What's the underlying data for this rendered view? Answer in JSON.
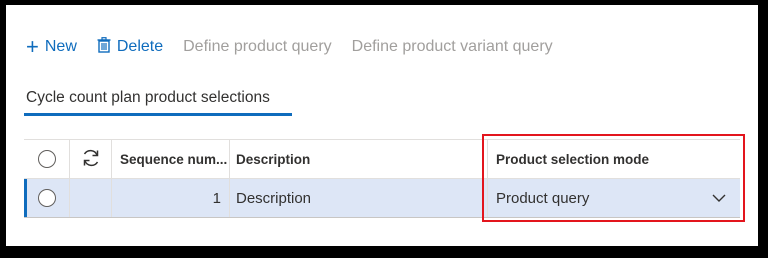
{
  "toolbar": {
    "new_label": "New",
    "delete_label": "Delete",
    "define_product_query_label": "Define product query",
    "define_product_variant_query_label": "Define product variant query"
  },
  "tab": {
    "label": "Cycle count plan product selections"
  },
  "grid": {
    "columns": {
      "sequence": "Sequence num...",
      "description": "Description",
      "product_selection_mode": "Product selection mode"
    },
    "rows": [
      {
        "sequence": "1",
        "description": "Description",
        "product_selection_mode": "Product query"
      }
    ]
  },
  "colors": {
    "accent": "#0f6cbd",
    "highlight": "#e3151d",
    "selected_row": "#dde6f6"
  }
}
